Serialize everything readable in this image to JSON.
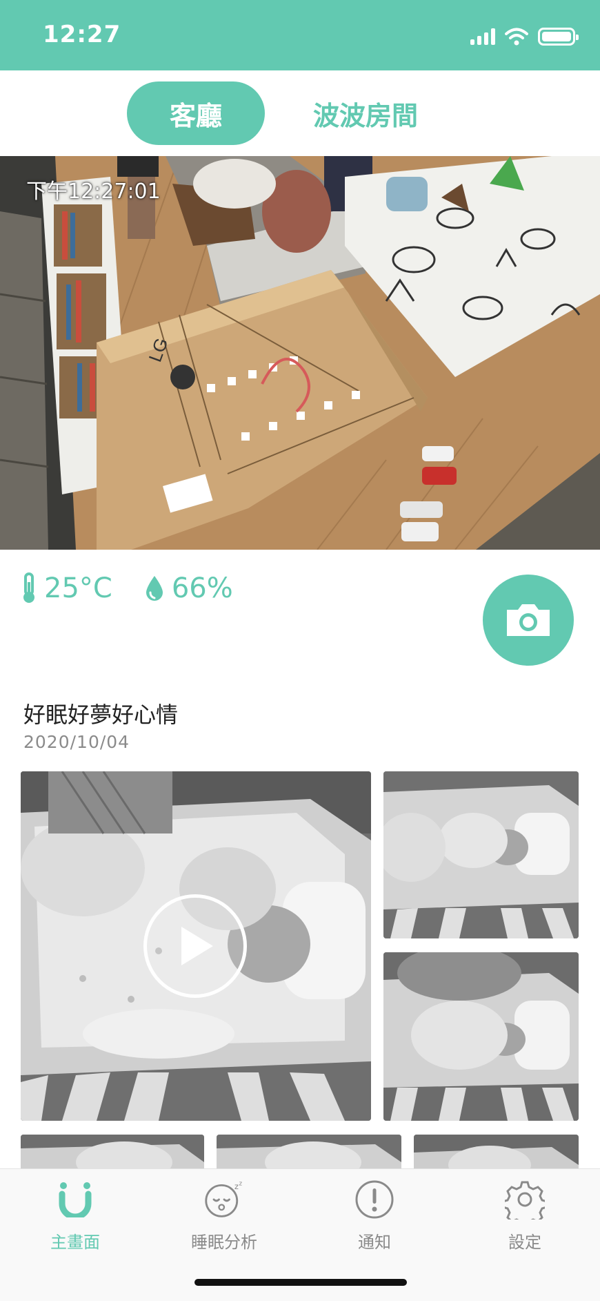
{
  "status_bar": {
    "time": "12:27",
    "icons": [
      "signal-icon",
      "wifi-icon",
      "battery-icon"
    ]
  },
  "rooms": {
    "active": "客廳",
    "inactive": "波波房間"
  },
  "camera": {
    "timestamp": "下午12:27:01"
  },
  "environment": {
    "temperature": "25°C",
    "humidity": "66%",
    "icons": [
      "thermometer-icon",
      "water-drop-icon"
    ]
  },
  "story": {
    "title": "好眠好夢好心情",
    "date": "2020/10/04"
  },
  "nav": {
    "home": "主畫面",
    "sleep": "睡眠分析",
    "notify": "通知",
    "settings": "設定",
    "active": "主畫面"
  },
  "colors": {
    "accent": "#62c9b1",
    "inactive_text": "#8a8a8a"
  }
}
